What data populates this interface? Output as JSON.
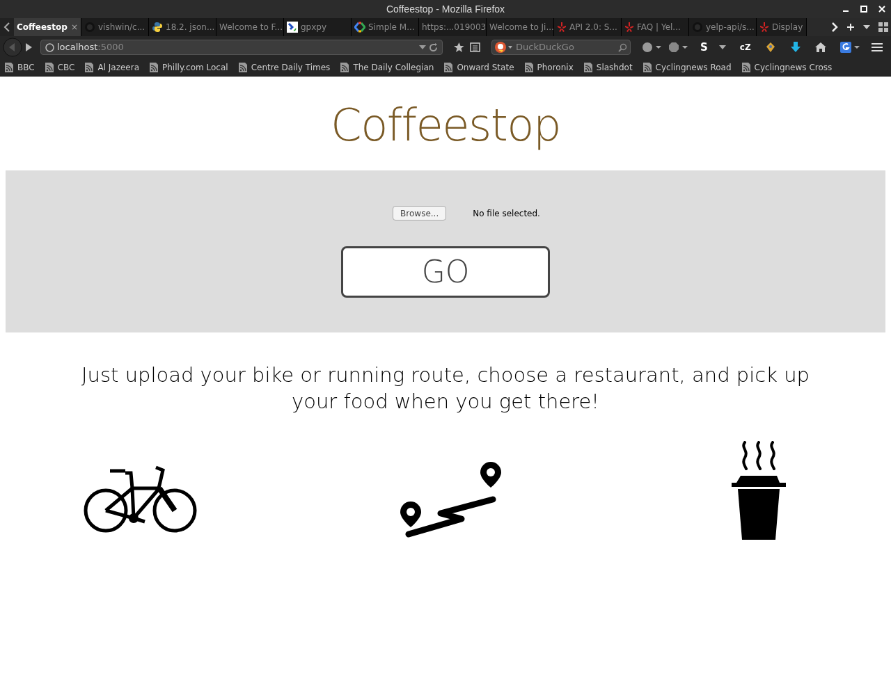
{
  "window": {
    "title": "Coffeestop - Mozilla Firefox"
  },
  "tabs": [
    {
      "label": "Coffeestop",
      "selected": true,
      "kind": "plain",
      "close": "×"
    },
    {
      "label": "vishwin/c...",
      "selected": false,
      "kind": "github"
    },
    {
      "label": "18.2. json...",
      "selected": false,
      "kind": "python"
    },
    {
      "label": "Welcome to F...",
      "selected": false,
      "kind": "plain"
    },
    {
      "label": "gpxpy",
      "selected": false,
      "kind": "gpx"
    },
    {
      "label": "Simple M...",
      "selected": false,
      "kind": "google"
    },
    {
      "label": "https:...019003",
      "selected": false,
      "kind": "plain"
    },
    {
      "label": "Welcome to Ji...",
      "selected": false,
      "kind": "plain"
    },
    {
      "label": "API 2.0: S...",
      "selected": false,
      "kind": "yelp"
    },
    {
      "label": "FAQ | Yel...",
      "selected": false,
      "kind": "yelp"
    },
    {
      "label": "yelp-api/s...",
      "selected": false,
      "kind": "github"
    },
    {
      "label": "Display",
      "selected": false,
      "kind": "yelp"
    }
  ],
  "address_bar": {
    "host": "localhost",
    "port": ":5000"
  },
  "search": {
    "placeholder": "DuckDuckGo"
  },
  "toolbar_texts": [
    "S",
    "cZ"
  ],
  "bookmarks": [
    "BBC",
    "CBC",
    "Al Jazeera",
    "Philly.com Local",
    "Centre Daily Times",
    "The Daily Collegian",
    "Onward State",
    "Phoronix",
    "Slashdot",
    "Cyclingnews Road",
    "Cyclingnews Cross"
  ],
  "page": {
    "heading": "Coffeestop",
    "browse_button": "Browse...",
    "file_status": "No file selected.",
    "go_button": "GO",
    "tagline": "Just upload your bike or running route, choose a restaurant, and pick up your food when you get there!",
    "features": [
      {
        "kind": "bike"
      },
      {
        "kind": "route"
      },
      {
        "kind": "coffee"
      }
    ]
  }
}
